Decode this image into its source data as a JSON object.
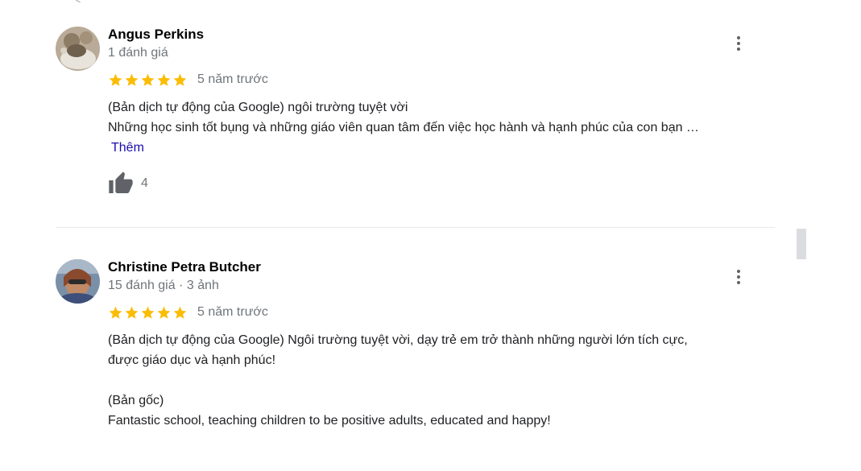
{
  "reviews": [
    {
      "name": "Angus Perkins",
      "meta": "1 đánh giá",
      "rating": 5,
      "time": "5 năm trước",
      "text_line1": "(Bản dịch tự động của Google) ngôi trường tuyệt vời",
      "text_line2": "Những học sinh tốt bụng và những giáo viên quan tâm đến việc học hành và hạnh phúc của con bạn …",
      "more_label": "Thêm",
      "likes": "4"
    },
    {
      "name": "Christine Petra Butcher",
      "meta": "15 đánh giá · 3 ảnh",
      "rating": 5,
      "time": "5 năm trước",
      "text_line1": "(Bản dịch tự động của Google) Ngôi trường tuyệt vời, dạy trẻ em trở thành những người lớn tích cực,",
      "text_line2": "được giáo dục và hạnh phúc!",
      "original_label": "(Bản gốc)",
      "original_text": "Fantastic school, teaching children to be positive adults, educated and happy!"
    }
  ],
  "icons": {
    "star": "star-icon",
    "menu": "more-vert-icon",
    "like": "thumbs-up-icon"
  },
  "colors": {
    "star": "#fbbc04",
    "link": "#1a0dab",
    "secondary_text": "#70757a",
    "icon": "#5f6368"
  }
}
